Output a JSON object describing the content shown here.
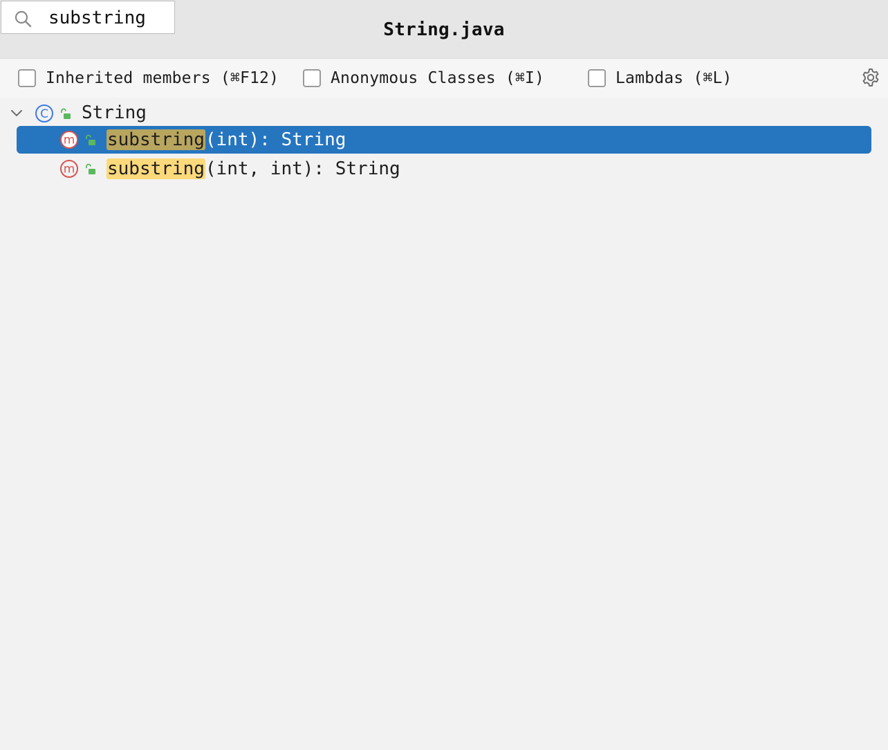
{
  "window": {
    "title": "String.java"
  },
  "search": {
    "value": "substring",
    "icon": "search-icon"
  },
  "options": {
    "inherited": {
      "label": "Inherited members (⌘F12)",
      "checked": false
    },
    "anonymous": {
      "label": "Anonymous Classes (⌘I)",
      "checked": false
    },
    "lambdas": {
      "label": "Lambdas (⌘L)",
      "checked": false
    },
    "settings_icon": "gear-icon"
  },
  "tree": {
    "root": {
      "label": "String",
      "icon": "class-icon",
      "expanded": true
    },
    "members": [
      {
        "match": "substring",
        "rest": "(int): String",
        "icon": "method-icon",
        "selected": true
      },
      {
        "match": "substring",
        "rest": "(int, int): String",
        "icon": "method-icon",
        "selected": false
      }
    ]
  },
  "colors": {
    "selection": "#2675bf",
    "match_highlight": "#fcd97a",
    "match_highlight_selected": "#b8a55e",
    "class_icon": "#3d7be0",
    "method_icon": "#d9534f",
    "lock_icon": "#5bb85d"
  }
}
